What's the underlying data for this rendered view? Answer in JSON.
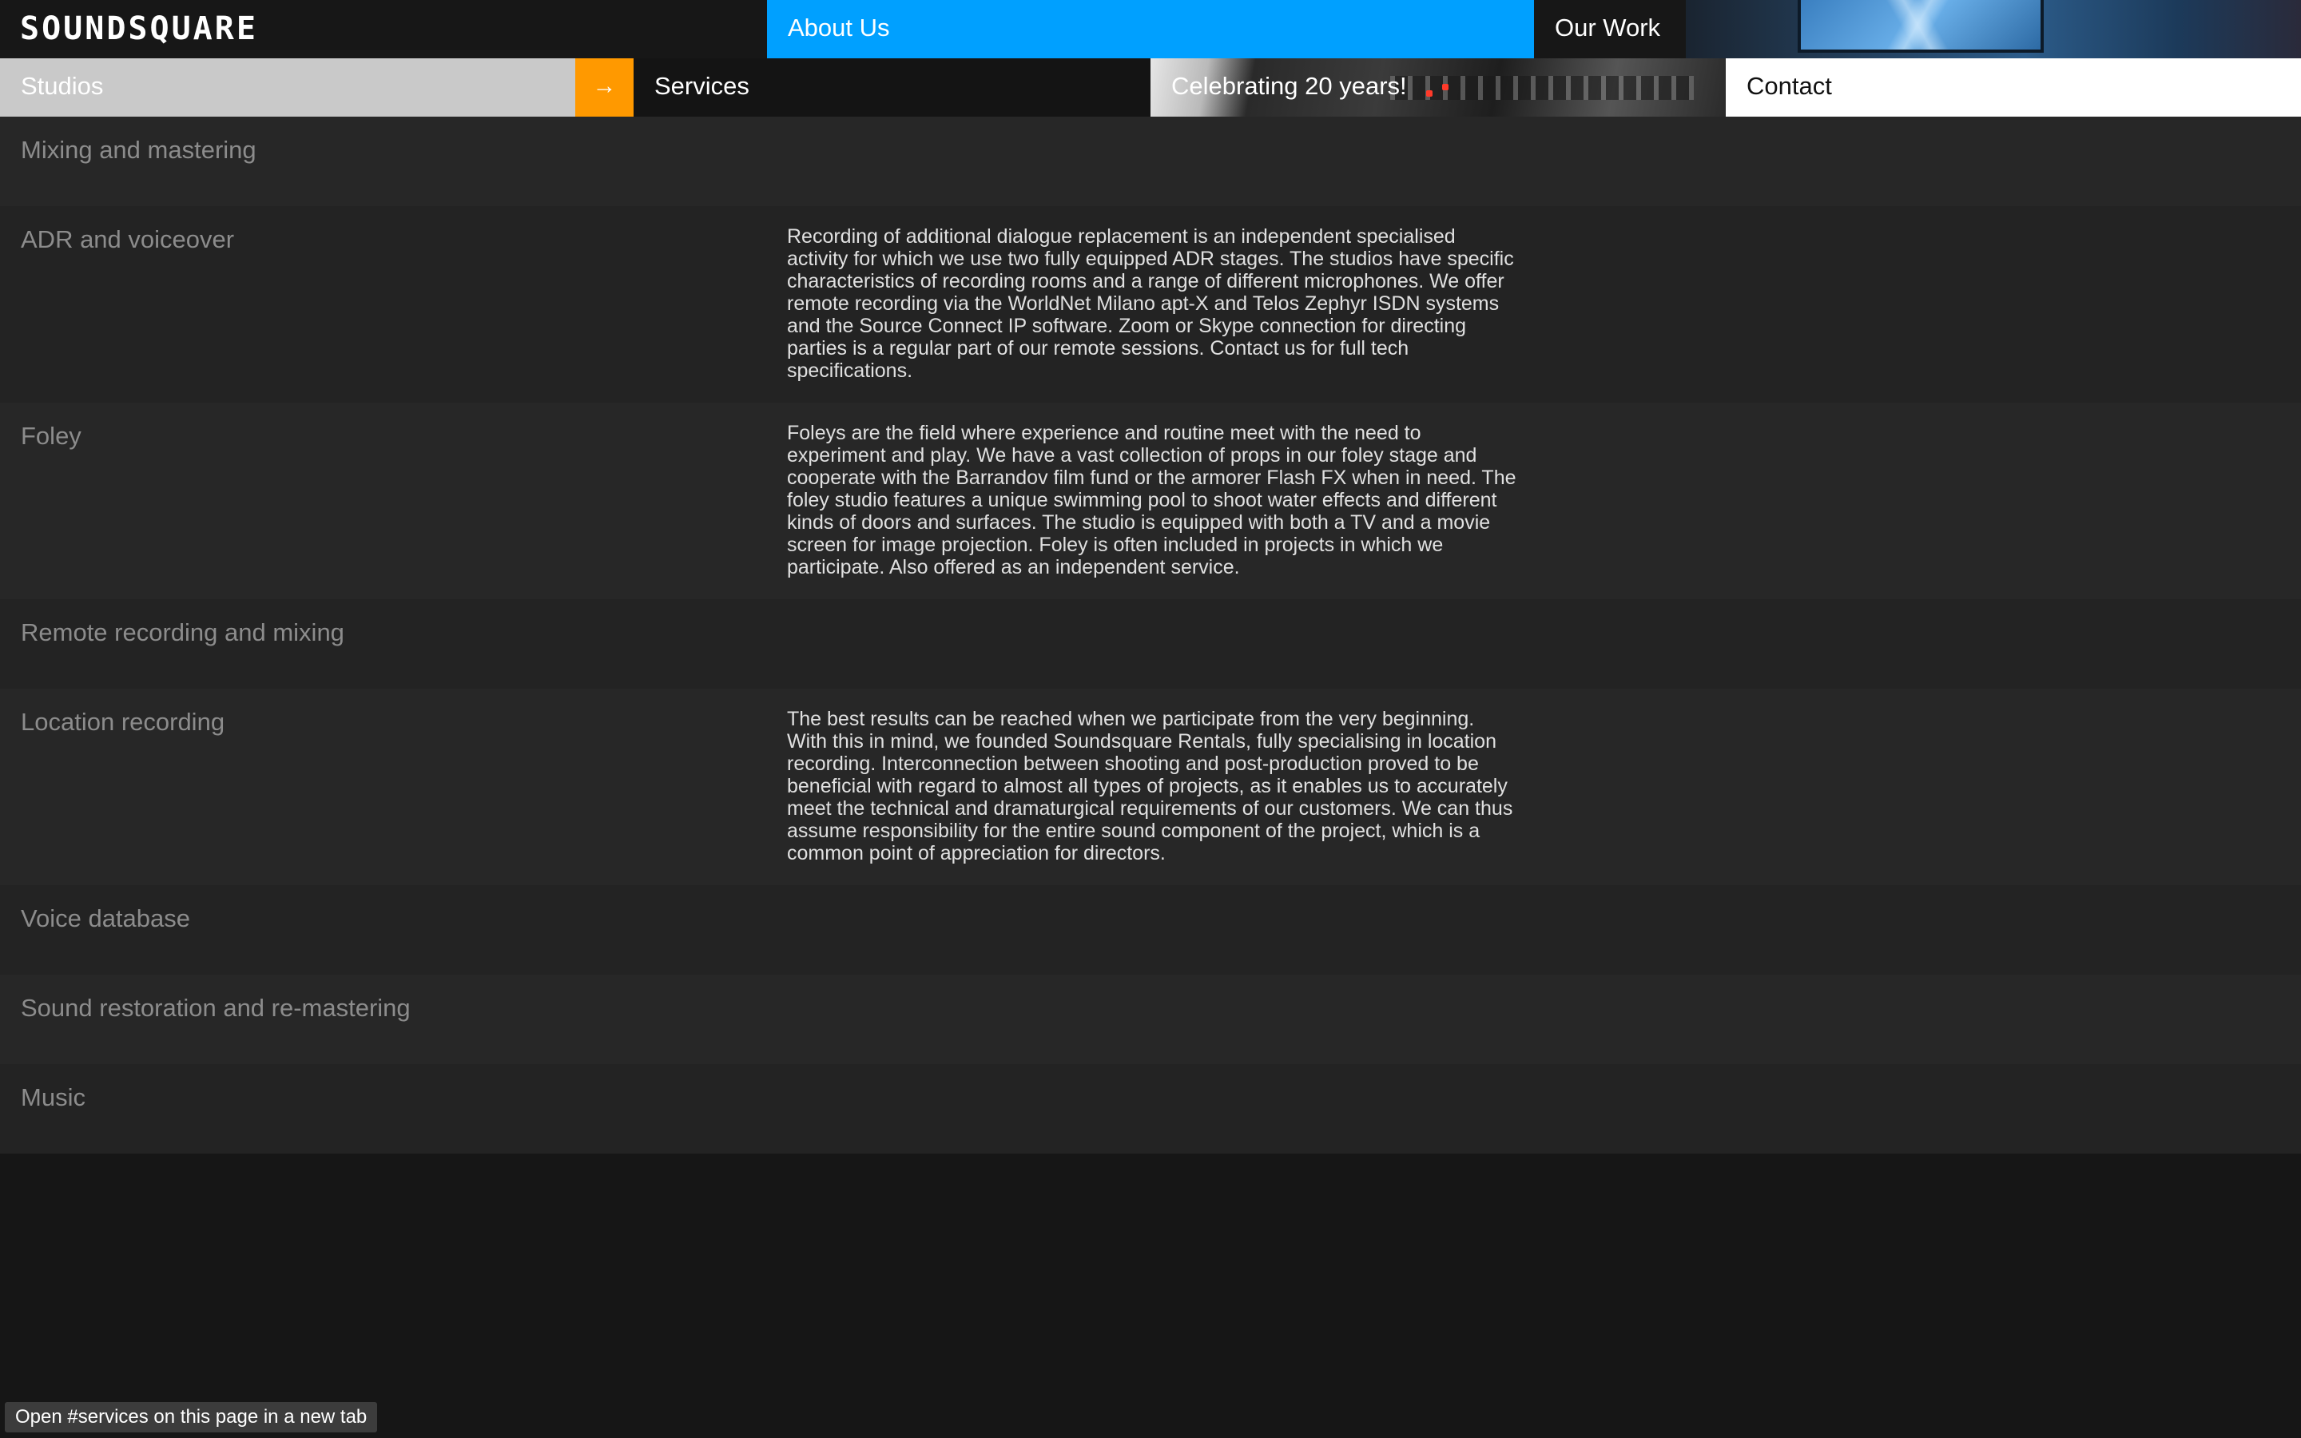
{
  "header": {
    "logo": "SOUNDSQUARE",
    "nav": {
      "about": "About Us",
      "work": "Our Work",
      "studios": "Studios",
      "services": "Services",
      "celebrate": "Celebrating 20 years!",
      "contact": "Contact"
    },
    "arrow_icon": "→"
  },
  "services": [
    {
      "title": "Mixing and mastering",
      "description": ""
    },
    {
      "title": "ADR and voiceover",
      "description": "Recording of additional dialogue replacement is an independent specialised activity for which we use two fully equipped ADR stages. The studios have specific characteristics of recording rooms and a range of different microphones. We offer remote recording via the WorldNet Milano apt-X and Telos Zephyr ISDN systems and the Source Connect IP software. Zoom or Skype connection for directing parties is a regular part of our remote sessions. Contact us for full tech specifications."
    },
    {
      "title": "Foley",
      "description": "Foleys are the field where experience and routine meet with the need to experiment and play. We have a vast collection of props in our foley stage and cooperate with the Barrandov film fund or the armorer Flash FX when in need. The foley studio features a unique swimming pool to shoot water effects and different kinds of doors and surfaces. The studio is equipped with both a TV and a movie screen for image projection. Foley is often included in projects in which we participate. Also offered as an independent service."
    },
    {
      "title": "Remote recording and mixing",
      "description": ""
    },
    {
      "title": "Location recording",
      "description": "The best results can be reached when we participate from the very beginning.\nWith this in mind, we founded Soundsquare Rentals, fully specialising in location recording. Interconnection between shooting and post-production proved to be beneficial with regard to almost all types of projects, as it enables us to accurately meet the technical and dramaturgical requirements of our customers. We can thus assume responsibility for the entire sound component of the project, which is a common point of appreciation for directors."
    },
    {
      "title": "Voice database",
      "description": ""
    },
    {
      "title": "Sound restoration and re-mastering",
      "description": ""
    },
    {
      "title": "Music",
      "description": ""
    }
  ],
  "status_tooltip": "Open #services on this page in a new tab",
  "colors": {
    "about_bg": "#00a0ff",
    "arrow_bg": "#ff9900",
    "studios_bg": "#c9c9c9",
    "contact_bg": "#ffffff",
    "page_bg": "#161616"
  }
}
